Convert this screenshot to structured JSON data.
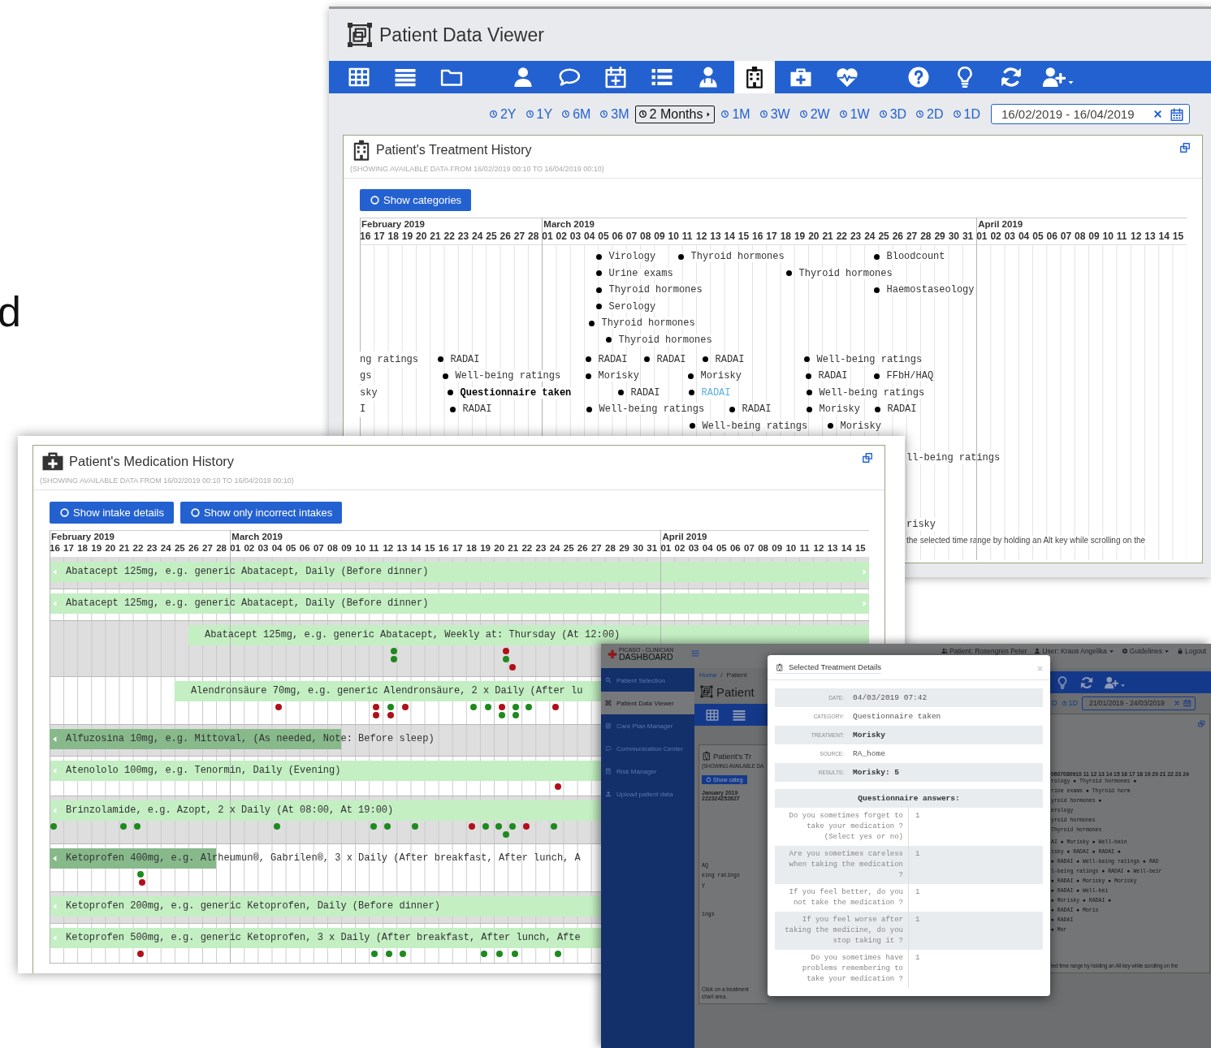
{
  "edge_fragment": "d",
  "viewer": {
    "title": "Patient Data Viewer",
    "toolbar": [
      [
        {
          "kind": "table",
          "selected": false
        },
        {
          "kind": "rows",
          "selected": false
        },
        {
          "kind": "folder",
          "selected": false
        }
      ],
      [
        {
          "kind": "user",
          "selected": false
        },
        {
          "kind": "comment",
          "selected": false
        },
        {
          "kind": "calendar-plus",
          "selected": false
        },
        {
          "kind": "list",
          "selected": false
        },
        {
          "kind": "doctor",
          "selected": false
        },
        {
          "kind": "hospital",
          "selected": true
        },
        {
          "kind": "medkit",
          "selected": false
        },
        {
          "kind": "heartbeat",
          "selected": false
        }
      ],
      [
        {
          "kind": "question",
          "selected": false
        },
        {
          "kind": "lightbulb",
          "selected": false
        },
        {
          "kind": "refresh",
          "selected": false
        },
        {
          "kind": "user-plus",
          "selected": false,
          "dropdown": true
        }
      ]
    ],
    "ranges": [
      {
        "label": "2Y",
        "selected": false
      },
      {
        "label": "1Y",
        "selected": false
      },
      {
        "label": "6M",
        "selected": false
      },
      {
        "label": "3M",
        "selected": false
      },
      {
        "label": "2 Months",
        "selected": true
      },
      {
        "label": "1M",
        "selected": false
      },
      {
        "label": "3W",
        "selected": false
      },
      {
        "label": "2W",
        "selected": false
      },
      {
        "label": "1W",
        "selected": false
      },
      {
        "label": "3D",
        "selected": false
      },
      {
        "label": "2D",
        "selected": false
      },
      {
        "label": "1D",
        "selected": false
      }
    ],
    "date_range": "16/02/2019 - 16/04/2019",
    "panel": {
      "title": "Patient's Treatment History",
      "subtitle": "(SHOWING AVAILABLE DATA FROM 16/02/2019 00:10 TO 16/04/2019 00:10)",
      "button": "Show categories",
      "months": [
        "February 2019",
        "March 2019",
        "April 2019"
      ],
      "days": [
        "16",
        "17",
        "18",
        "19",
        "20",
        "21",
        "22",
        "23",
        "24",
        "25",
        "26",
        "27",
        "28",
        "01",
        "02",
        "03",
        "04",
        "05",
        "06",
        "07",
        "08",
        "09",
        "10",
        "11",
        "12",
        "13",
        "14",
        "15",
        "16",
        "17",
        "18",
        "19",
        "20",
        "21",
        "22",
        "23",
        "24",
        "25",
        "26",
        "27",
        "28",
        "29",
        "30",
        "31",
        "01",
        "02",
        "03",
        "04",
        "05",
        "06",
        "07",
        "08",
        "09",
        "10",
        "11",
        "12",
        "13",
        "14",
        "15"
      ],
      "lines": [
        {
          "events": [
            {
              "label": "Virology",
              "kind": "plain"
            },
            {
              "label": "Thyroid hormones",
              "kind": "plain"
            },
            {
              "label": "Bloodcount",
              "kind": "plain"
            }
          ]
        },
        {
          "events": [
            {
              "label": "Urine exams",
              "kind": "plain"
            },
            {
              "label": "Thyroid hormones",
              "kind": "plain"
            }
          ]
        },
        {
          "events": [
            {
              "label": "Thyroid hormones",
              "kind": "plain"
            },
            {
              "label": "Haemostaseology",
              "kind": "plain"
            }
          ]
        },
        {
          "events": [
            {
              "label": "Serology",
              "kind": "plain"
            }
          ]
        },
        {
          "events": [
            {
              "label": "Thyroid hormones",
              "kind": "plain"
            }
          ]
        },
        {
          "events": [
            {
              "label": "Thyroid hormones",
              "kind": "plain"
            }
          ]
        },
        {
          "clipped_text": "ng ratings",
          "events": [
            {
              "label": "RADAI",
              "kind": "plain"
            },
            {
              "label": "RADAI",
              "kind": "plain"
            },
            {
              "label": "RADAI",
              "kind": "plain"
            },
            {
              "label": "RADAI",
              "kind": "plain"
            },
            {
              "label": "Well-being ratings",
              "kind": "plain"
            }
          ]
        },
        {
          "clipped_text": "gs",
          "events": [
            {
              "label": "Well-being ratings",
              "kind": "plain"
            },
            {
              "label": "Morisky",
              "kind": "plain"
            },
            {
              "label": "Morisky",
              "kind": "plain"
            },
            {
              "label": "RADAI",
              "kind": "plain"
            },
            {
              "label": "FFbH/HAQ",
              "kind": "plain"
            }
          ]
        },
        {
          "clipped_text": "sky",
          "events": [
            {
              "label": "Questionnaire taken",
              "kind": "bold"
            },
            {
              "label": "RADAI",
              "kind": "plain"
            },
            {
              "label": "RADAI",
              "kind": "link"
            },
            {
              "label": "Well-being ratings",
              "kind": "plain"
            }
          ]
        },
        {
          "clipped_text": "I",
          "events": [
            {
              "label": "RADAI",
              "kind": "plain"
            },
            {
              "label": "Well-being ratings",
              "kind": "plain"
            },
            {
              "label": "RADAI",
              "kind": "plain"
            },
            {
              "label": "Morisky",
              "kind": "plain"
            },
            {
              "label": "RADAI",
              "kind": "plain"
            }
          ]
        },
        {
          "events": [
            {
              "label": "Well-being ratings",
              "kind": "plain"
            },
            {
              "label": "Morisky",
              "kind": "plain"
            }
          ]
        }
      ],
      "hidden_fragments": [
        {
          "kind": "event",
          "text": "ll-being ratings"
        },
        {
          "kind": "event",
          "text": "risky"
        },
        {
          "kind": "note",
          "text": "the selected time range by holding an Alt key while scrolling on the"
        }
      ]
    }
  },
  "medication": {
    "title": "Patient's Medication History",
    "subtitle": "(SHOWING AVAILABLE DATA FROM 16/02/2019 00:10 TO 16/04/2019 00:10)",
    "buttons": [
      "Show intake details",
      "Show only incorrect intakes"
    ],
    "months": [
      "February 2019",
      "March 2019",
      "April 2019"
    ],
    "days": [
      "16",
      "17",
      "18",
      "19",
      "20",
      "21",
      "22",
      "23",
      "24",
      "25",
      "26",
      "27",
      "28",
      "01",
      "02",
      "03",
      "04",
      "05",
      "06",
      "07",
      "08",
      "09",
      "10",
      "11",
      "12",
      "13",
      "14",
      "15",
      "16",
      "17",
      "18",
      "19",
      "20",
      "21",
      "22",
      "23",
      "24",
      "25",
      "26",
      "27",
      "28",
      "29",
      "30",
      "31",
      "01",
      "02",
      "03",
      "04",
      "05",
      "06",
      "07",
      "08",
      "09",
      "10",
      "11",
      "12",
      "13",
      "14",
      "15"
    ],
    "rows": [
      {
        "label": "Abatacept 125mg, e.g. generic Abatacept, Daily (Before dinner)",
        "kind": "active",
        "continues_before": true,
        "continues_after": true,
        "intakes": []
      },
      {
        "label": "Abatacept 125mg, e.g. generic Abatacept, Daily (Before dinner)",
        "kind": "active",
        "continues_before": true,
        "continues_after": true,
        "intakes": []
      },
      {
        "label": "Abatacept 125mg, e.g. generic Abatacept, Weekly at: Thursday (At 12:00)",
        "kind": "active",
        "intakes": [
          {
            "color": "#1e8a1e"
          },
          {
            "color": "#1e8a1e"
          },
          {
            "color": "#b0101a"
          },
          {
            "color": "#1e8a1e"
          },
          {
            "color": "#b0101a"
          }
        ]
      },
      {
        "label": "Alendronsäure 70mg, e.g. generic Alendronsäure, 2 x Daily (After lu",
        "kind": "active",
        "intakes": [
          {
            "color": "#b0101a"
          },
          {
            "color": "#b0101a"
          },
          {
            "color": "#b0101a"
          },
          {
            "color": "#1e8a1e"
          },
          {
            "color": "#b0101a"
          },
          {
            "color": "#b0101a"
          },
          {
            "color": "#1e8a1e"
          },
          {
            "color": "#1e8a1e"
          },
          {
            "color": "#b0101a"
          },
          {
            "color": "#1e8a1e"
          },
          {
            "color": "#1e8a1e"
          },
          {
            "color": "#1e8a1e"
          },
          {
            "color": "#1e8a1e"
          },
          {
            "color": "#b0101a"
          }
        ]
      },
      {
        "label": "Alfuzosina 10mg, e.g. Mittoval, (As needed, Note: Before sleep)",
        "kind": "ended",
        "continues_before": true,
        "intakes": []
      },
      {
        "label": "Atenololo 100mg, e.g. Tenormin, Daily (Evening)",
        "kind": "active",
        "continues_before": true,
        "intakes": [
          {
            "color": "#b0101a"
          }
        ]
      },
      {
        "label": "Brinzolamide, e.g. Azopt, 2 x Daily (At 08:00, At 19:00)",
        "kind": "active",
        "continues_before": true,
        "intakes": [
          {
            "color": "#1e8a1e"
          },
          {
            "color": "#1e8a1e"
          },
          {
            "color": "#1e8a1e"
          },
          {
            "color": "#1e8a1e"
          },
          {
            "color": "#1e8a1e"
          },
          {
            "color": "#1e8a1e"
          },
          {
            "color": "#1e8a1e"
          },
          {
            "color": "#b0101a"
          },
          {
            "color": "#1e8a1e"
          },
          {
            "color": "#1e8a1e"
          },
          {
            "color": "#1e8a1e"
          },
          {
            "color": "#1e8a1e"
          },
          {
            "color": "#b0101a"
          },
          {
            "color": "#1e8a1e"
          }
        ]
      },
      {
        "label": "Ketoprofen 400mg, e.g. Alrheumun®, Gabrilen®, 3 x Daily (After breakfast, After lunch, A",
        "kind": "ended",
        "continues_before": true,
        "intakes": [
          {
            "color": "#1e8a1e"
          },
          {
            "color": "#b0101a"
          }
        ]
      },
      {
        "label": "Ketoprofen 200mg, e.g. generic Ketoprofen, Daily (Before dinner)",
        "kind": "active",
        "continues_before": true,
        "intakes": []
      },
      {
        "label": "Ketoprofen 500mg, e.g. generic Ketoprofen, 3 x Daily (After breakfast, After lunch, Afte",
        "kind": "active",
        "continues_before": true,
        "intakes": [
          {
            "color": "#b0101a"
          },
          {
            "color": "#1e8a1e"
          },
          {
            "color": "#1e8a1e"
          },
          {
            "color": "#1e8a1e"
          },
          {
            "color": "#1e8a1e"
          },
          {
            "color": "#1e8a1e"
          },
          {
            "color": "#1e8a1e"
          },
          {
            "color": "#1e8a1e"
          }
        ]
      }
    ]
  },
  "dashboard": {
    "logo": {
      "top": "PICASO - CLINICIAN",
      "bottom": "DASHBOARD"
    },
    "header_items": [
      {
        "kind": "users",
        "label": "Patient: Rosengren Peter"
      },
      {
        "kind": "user",
        "label": "User: Kraus Angelika",
        "dropdown": true
      },
      {
        "kind": "gear",
        "label": "Guidelines",
        "dropdown": true
      },
      {
        "kind": "lock",
        "label": "Logout"
      }
    ],
    "nav": [
      {
        "kind": "search",
        "label": "Patient Selection",
        "selected": false
      },
      {
        "kind": "viewer",
        "label": "Patient Data Viewer",
        "selected": true
      },
      {
        "kind": "clipboard",
        "label": "Care Plan Manager",
        "selected": false
      },
      {
        "kind": "comment",
        "label": "Communication Center",
        "selected": false
      },
      {
        "kind": "calculator",
        "label": "Risk Manager",
        "selected": false
      },
      {
        "kind": "upload",
        "label": "Upload patient data",
        "selected": false
      }
    ],
    "breadcrumb": [
      "Home",
      "Patient"
    ],
    "breadcrumb_separator": "/",
    "page_title": "Patient",
    "toolbar_left": [
      {
        "kind": "table"
      },
      {
        "kind": "rows"
      }
    ],
    "toolbar_right": [
      {
        "kind": "lightbulb"
      },
      {
        "kind": "refresh"
      },
      {
        "kind": "user-plus",
        "dropdown": true
      }
    ],
    "ranges": [
      {
        "label": "D",
        "cut": true
      },
      {
        "label": "1D",
        "cut": false
      }
    ],
    "date_range": "21/01/2019 - 24/03/2019",
    "panel": {
      "title": "Patient's Tr",
      "subtitle": "(SHOWING AVAILABLE DA",
      "button": "Show categ",
      "month": "January 2019",
      "days": "222324252627",
      "left_lines": [
        "AQ",
        "eing ratings",
        "y",
        "ings"
      ],
      "day_header": "0607080910 11 12 13 14 15 16 17 18 19 20 21 22 23 24",
      "right_lines": [
        "rology ● Thyroid hormones ●",
        "rine exams ● Thyroid horm",
        "yroid hormones ●",
        "erology",
        "yroid hormones",
        "Thyroid hormones",
        "AI ● Morisky ● Well-bein",
        "isky ● RADAI ● RADAI ●",
        "● RADAI ● Well-being ratings ● RAD",
        "l-being ratings ● RADAI ● Well-beir",
        "● RADAI ● Morisky ● Morisky",
        "● RADAI ● Well-bei",
        "● Morisky ● RADAI ●",
        "● RADAI ● Moris",
        "● RADAI",
        "● Mor"
      ],
      "footer_left": [
        "Click on a treatment",
        "chart area."
      ],
      "footer_right": "ted time range by holding an Alt key while scrolling on the"
    }
  },
  "modal": {
    "title": "Selected Treatment Details",
    "fields": [
      {
        "label": "DATE:",
        "value": "04/03/2019 07:42",
        "emphasis": false
      },
      {
        "label": "CATEGORY:",
        "value": "Questionnaire taken",
        "emphasis": false
      },
      {
        "label": "TREATMENT:",
        "value": "Morisky",
        "emphasis": true
      },
      {
        "label": "SOURCE:",
        "value": "RA_home",
        "emphasis": false
      },
      {
        "label": "RESULTS:",
        "value": "Morisky: 5",
        "emphasis": true
      }
    ],
    "answers_heading": "Questionnaire answers:",
    "answers": [
      {
        "question": "Do you sometimes forget to take your medication ? (Select yes or no)",
        "answer": "1"
      },
      {
        "question": "Are you sometimes careless when taking the medication ?",
        "answer": "1"
      },
      {
        "question": "If you feel better, do you not take the medication ?",
        "answer": "1"
      },
      {
        "question": "If you feel worse after taking the medicine, do you stop taking it ?",
        "answer": "1"
      },
      {
        "question": "Do you sometimes have problems remembering to take your medication ?",
        "answer": "1"
      }
    ]
  }
}
